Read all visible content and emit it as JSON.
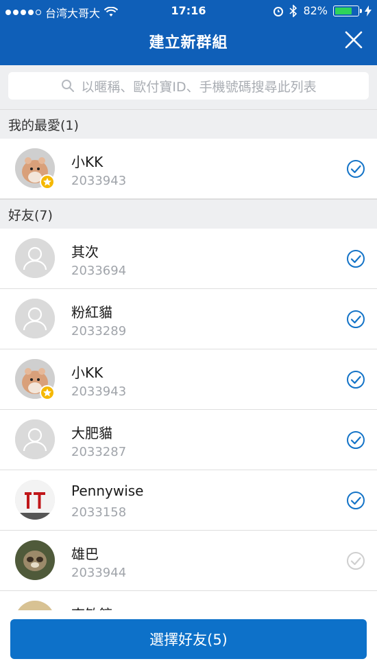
{
  "status_bar": {
    "carrier": "台湾大哥大",
    "time": "17:16",
    "battery_percent": "82%",
    "battery_level": 0.82
  },
  "header": {
    "title": "建立新群組",
    "close_icon": "close-icon"
  },
  "search": {
    "placeholder": "以暱稱、歐付寶ID、手機號碼搜尋此列表"
  },
  "sections": [
    {
      "title": "我的最愛(1)",
      "items": [
        {
          "name": "小KK",
          "id": "2033943",
          "avatar": "hamster",
          "favorite": true,
          "selected": true
        }
      ]
    },
    {
      "title": "好友(7)",
      "items": [
        {
          "name": "其次",
          "id": "2033694",
          "avatar": "default",
          "favorite": false,
          "selected": true
        },
        {
          "name": "粉紅貓",
          "id": "2033289",
          "avatar": "default",
          "favorite": false,
          "selected": true
        },
        {
          "name": "小KK",
          "id": "2033943",
          "avatar": "hamster",
          "favorite": true,
          "selected": true
        },
        {
          "name": "大肥貓",
          "id": "2033287",
          "avatar": "default",
          "favorite": false,
          "selected": true
        },
        {
          "name": "Pennywise",
          "id": "2033158",
          "avatar": "it",
          "favorite": false,
          "selected": true
        },
        {
          "name": "雄巴",
          "id": "2033944",
          "avatar": "sloth",
          "favorite": false,
          "selected": false
        },
        {
          "name": "李敏鎬",
          "id": "",
          "avatar": "photo",
          "favorite": false,
          "selected": false
        }
      ]
    }
  ],
  "footer": {
    "button_label": "選擇好友(5)"
  },
  "colors": {
    "header_bg": "#0f5fb8",
    "button_bg": "#0d71c9",
    "check_selected": "#1373c7",
    "check_unselected": "#cfcfcf",
    "section_bg": "#eeeff1"
  }
}
